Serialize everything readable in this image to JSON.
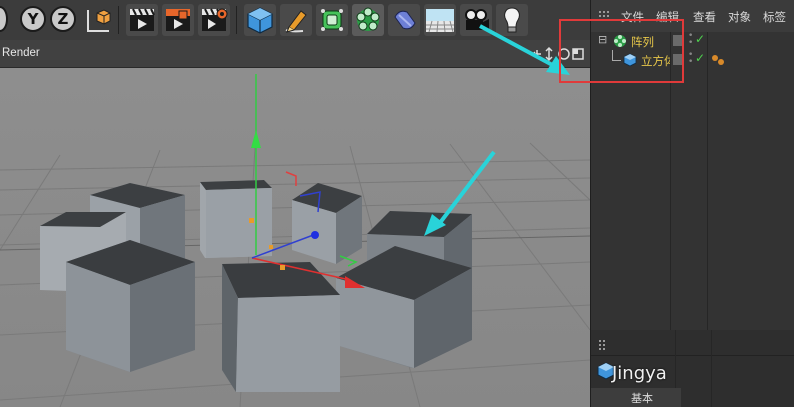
{
  "toolbar": {
    "axis_buttons": [
      "Y",
      "Z"
    ],
    "items": [
      "render-view-icon",
      "render-picture-viewer-icon",
      "render-settings-icon",
      "cube-primitive-icon",
      "pen-spline-icon",
      "subdivision-surface-icon",
      "mograph-cloner-icon",
      "deformer-icon",
      "floor-scene-icon",
      "camera-icon",
      "light-icon"
    ]
  },
  "viewport": {
    "title": "Render"
  },
  "object_manager": {
    "menu": [
      "文件",
      "编辑",
      "查看",
      "对象",
      "标签"
    ],
    "objects": [
      {
        "name": "阵列",
        "icon": "cloner-icon",
        "check": "✓"
      },
      {
        "name": "立方体",
        "icon": "cube-icon",
        "check": "✓"
      }
    ]
  },
  "attribute_panel": {
    "tab": "基本",
    "watermark": "Jingya"
  },
  "colors": {
    "annotation_arrow": "#29d3d9",
    "highlight_box": "#e03a3a",
    "object_name": "#e7c74a"
  }
}
